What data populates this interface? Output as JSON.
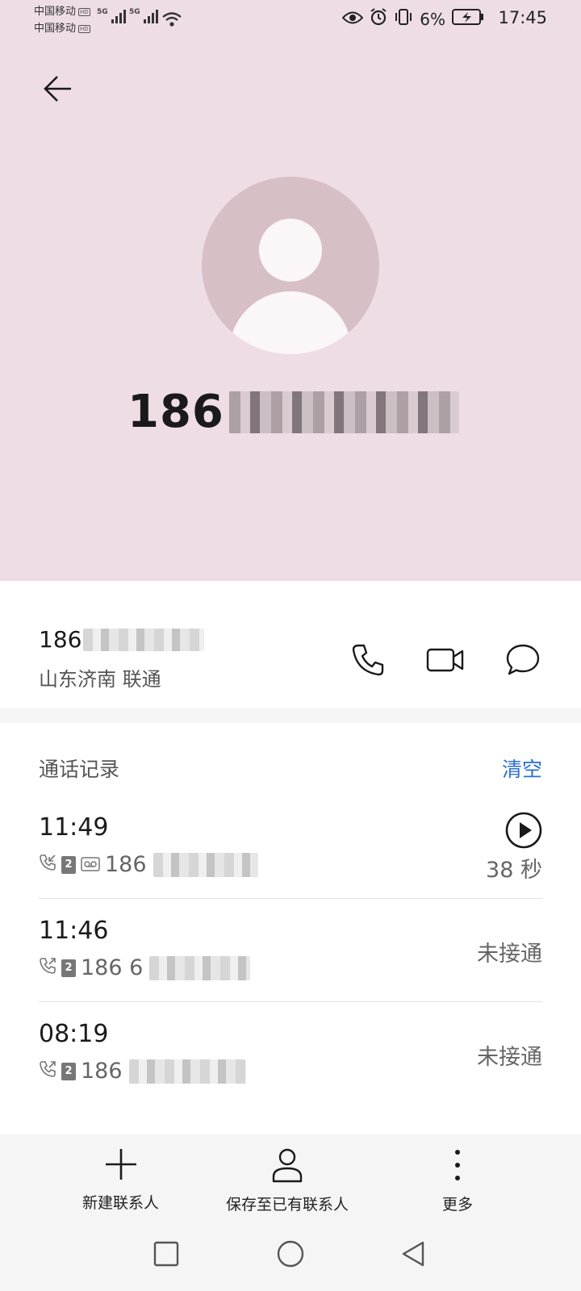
{
  "status_bar": {
    "carrier_1": "中国移动",
    "carrier_2": "中国移动",
    "network_1": "5G",
    "network_2": "5G",
    "battery": "6%",
    "time": "17:45"
  },
  "header": {
    "back_icon": "arrow-left-icon",
    "avatar_icon": "person-avatar-icon",
    "number_prefix": "186",
    "background_color": "#eedde5"
  },
  "contact": {
    "number_prefix": "186",
    "location": "山东济南 联通",
    "actions": [
      "phone-icon",
      "video-call-icon",
      "message-icon"
    ]
  },
  "history": {
    "title": "通话记录",
    "clear_label": "清空",
    "accent_color": "#2a6fd6",
    "calls": [
      {
        "time": "11:49",
        "sim": "2",
        "number_prefix": "186",
        "duration": "38 秒",
        "status": ""
      },
      {
        "time": "11:46",
        "sim": "2",
        "number_prefix": "186 6",
        "duration": "",
        "status": "未接通"
      },
      {
        "time": "08:19",
        "sim": "2",
        "number_prefix": "186",
        "duration": "",
        "status": "未接通"
      }
    ]
  },
  "bottom_actions": [
    {
      "label": "新建联系人",
      "icon": "plus-icon"
    },
    {
      "label": "保存至已有联系人",
      "icon": "person-icon"
    },
    {
      "label": "更多",
      "icon": "more-vertical-icon"
    }
  ],
  "nav": [
    "recent-apps-icon",
    "home-icon",
    "back-triangle-icon"
  ]
}
